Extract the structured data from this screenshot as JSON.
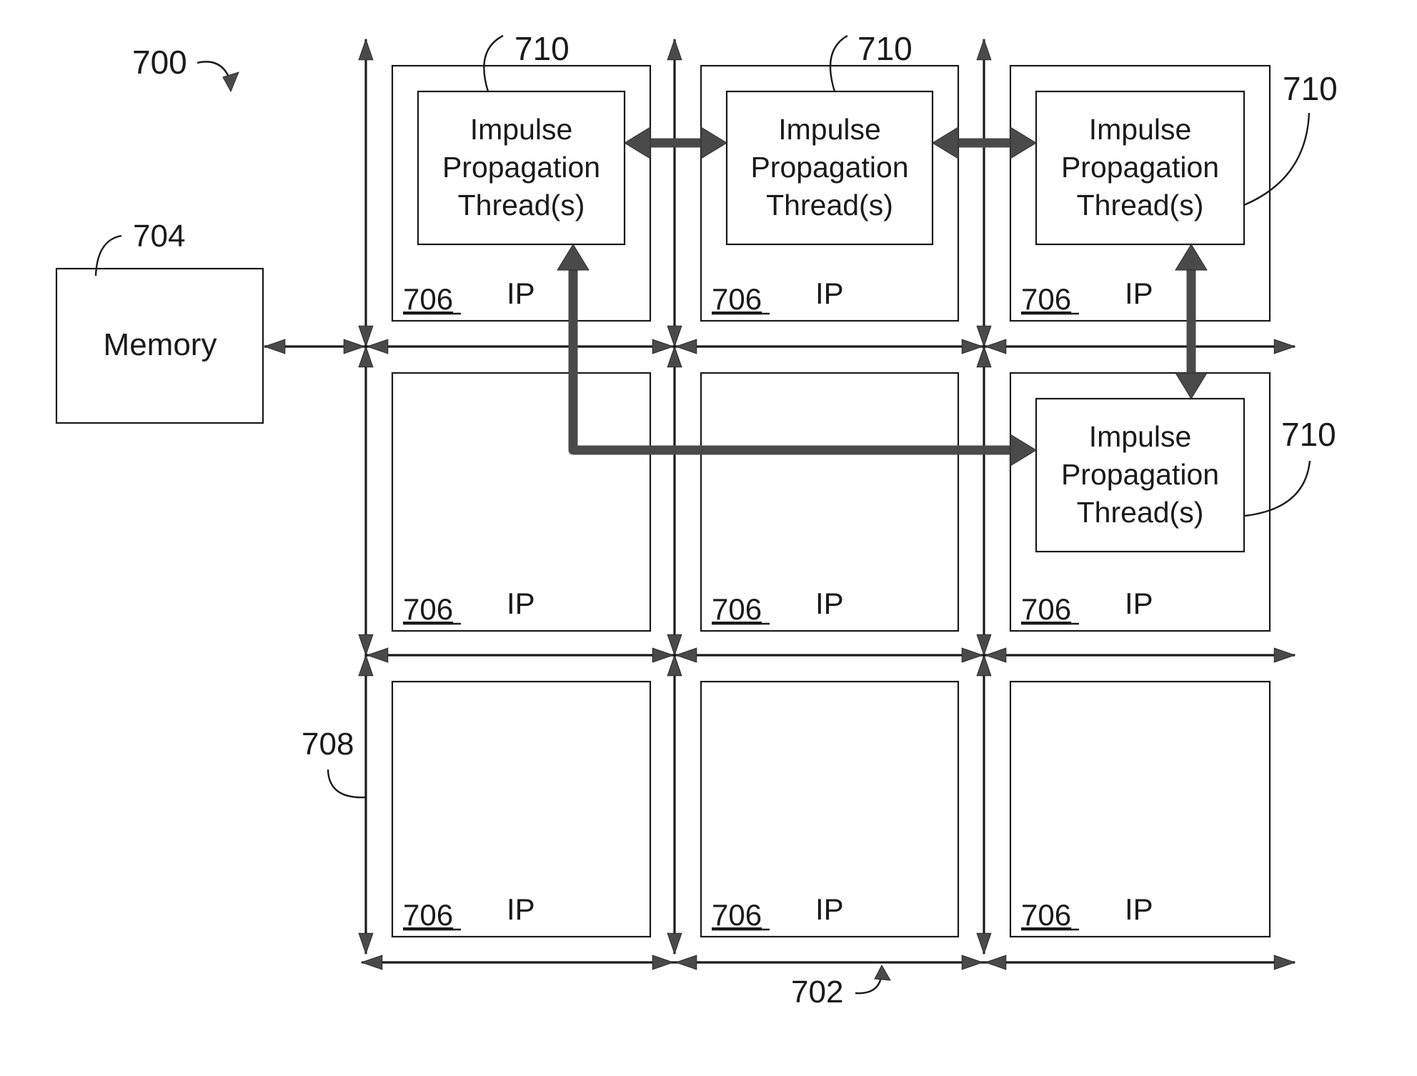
{
  "figure": {
    "ref": "700",
    "memory": {
      "ref": "704",
      "label": "Memory"
    },
    "interconnect_ref": "702",
    "bus_ref": "708",
    "ip_ref": "706",
    "ip_label": "IP",
    "thread_ref": "710",
    "thread_label_lines": [
      "Impulse",
      "Propagation",
      "Thread(s)"
    ],
    "grid": {
      "rows": 3,
      "cols": 3,
      "cells_with_threads": [
        {
          "row": 0,
          "col": 0
        },
        {
          "row": 0,
          "col": 1
        },
        {
          "row": 0,
          "col": 2
        },
        {
          "row": 1,
          "col": 2
        }
      ]
    },
    "thread_links": [
      {
        "from": "r0c0",
        "to": "r0c1",
        "style": "bidirectional"
      },
      {
        "from": "r0c1",
        "to": "r0c2",
        "style": "bidirectional"
      },
      {
        "from": "r0c2",
        "to": "r1c2",
        "style": "bidirectional"
      },
      {
        "from": "r0c0",
        "to": "r1c2",
        "style": "routed-bidirectional"
      }
    ]
  }
}
